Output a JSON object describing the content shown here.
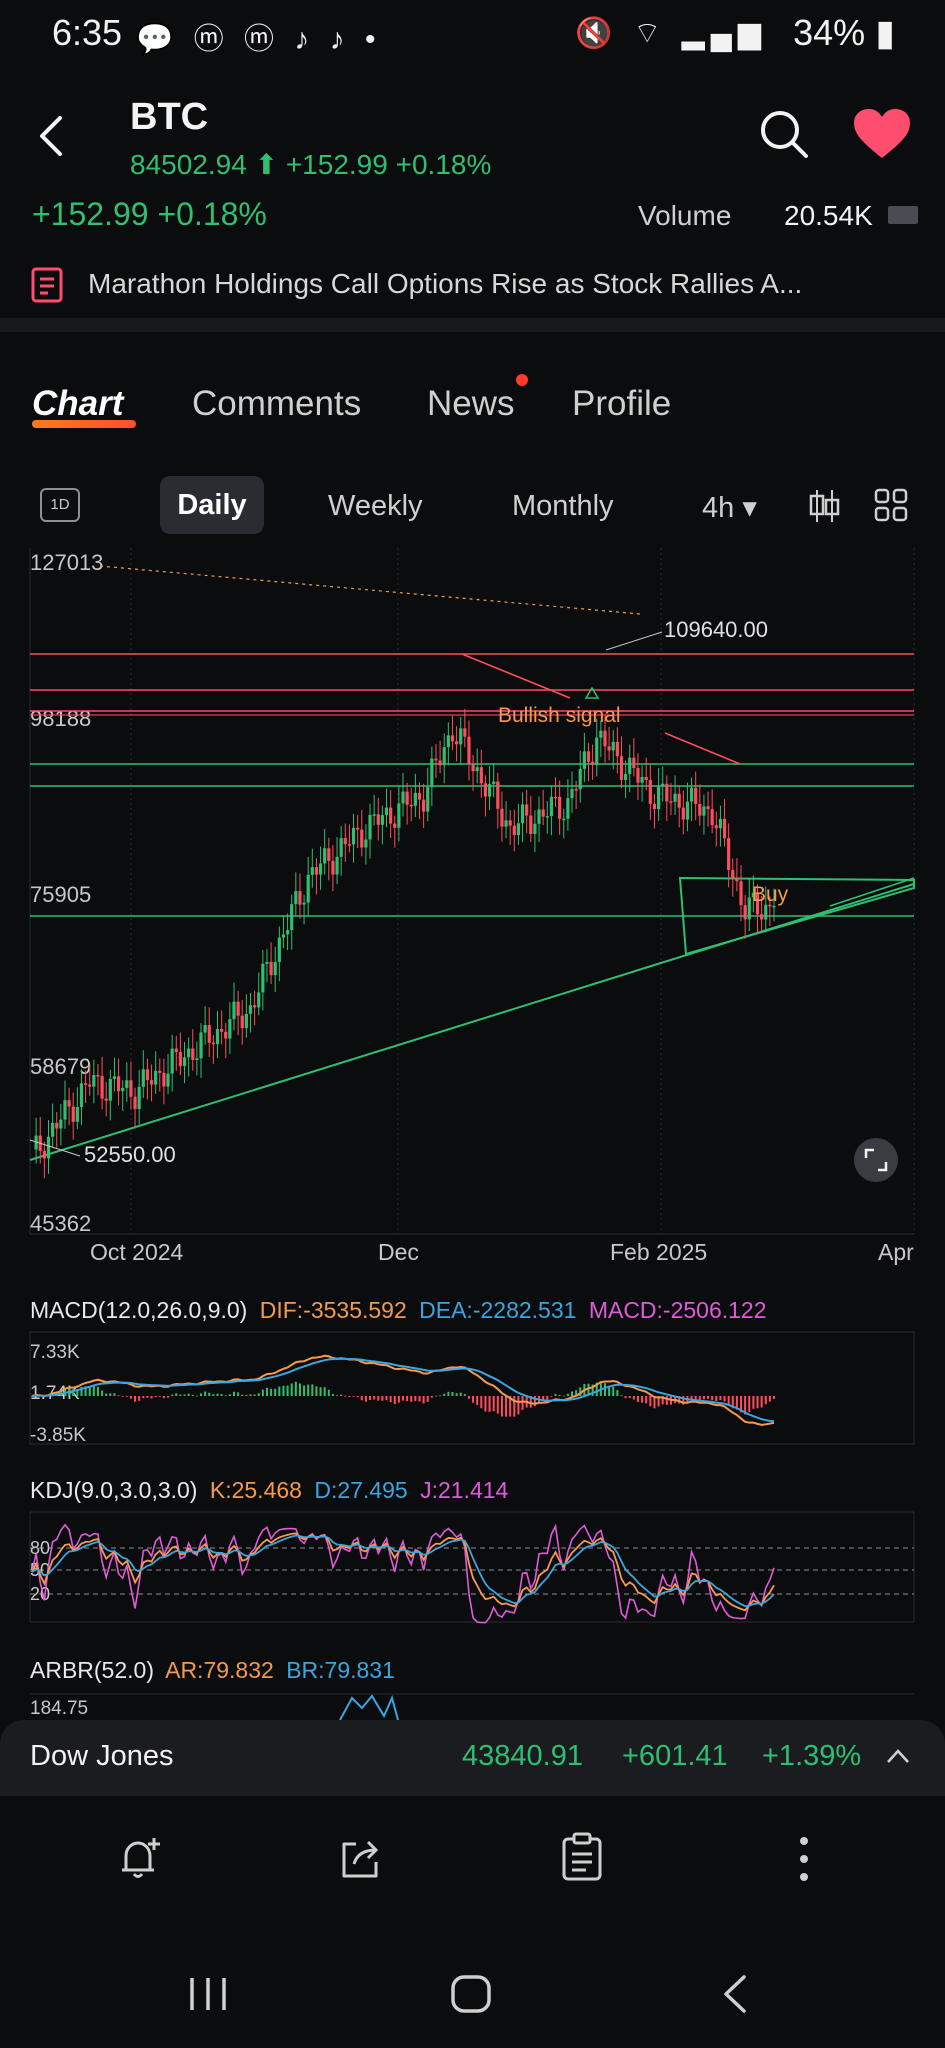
{
  "status_bar": {
    "time": "6:35",
    "left_icons": "💬 ⓜ ⓜ ♪ ♪ •",
    "battery": "34%",
    "right_icons": "🔇 ⌔ ▂▄▆"
  },
  "header": {
    "title": "BTC",
    "price": "84502.94",
    "arrow": "⬆",
    "change": "+152.99",
    "change_pct": "+0.18%"
  },
  "scrolled_row": {
    "change_ghost": "+152.99 +0.18%",
    "volume_label": "Volume",
    "volume_value": "20.54K"
  },
  "news_banner": {
    "text": "Marathon Holdings Call Options Rise as Stock Rallies A..."
  },
  "tabs": [
    {
      "label": "Chart",
      "active": true
    },
    {
      "label": "Comments",
      "active": false
    },
    {
      "label": "News",
      "active": false
    },
    {
      "label": "Profile",
      "active": false
    }
  ],
  "periods": {
    "oned_label": "1D",
    "items": [
      "Daily",
      "Weekly",
      "Monthly",
      "4h ▾"
    ],
    "selected": "Daily"
  },
  "colors": {
    "up": "#2fbf71",
    "down": "#ff4d5e",
    "orange": "#f59a4c",
    "blue": "#3aa6e0",
    "pink": "#e05ad9"
  },
  "chart_data": {
    "type": "candlestick",
    "y_labels": [
      "127013",
      "98188",
      "75905",
      "58679",
      "45362"
    ],
    "x_labels": [
      "Oct 2024",
      "Dec",
      "Feb 2025",
      "Apr"
    ],
    "annotations": {
      "high_label": "109640.00",
      "low_label": "52550.00",
      "signal_label": "Bullish signal",
      "buy_label": "Buy"
    },
    "ylim": [
      45362,
      127013
    ],
    "series": [
      {
        "date": "2024-09-06",
        "close": 54000
      },
      {
        "date": "2024-09-20",
        "close": 63000
      },
      {
        "date": "2024-10-01",
        "close": 62000
      },
      {
        "date": "2024-10-15",
        "close": 67000
      },
      {
        "date": "2024-10-29",
        "close": 72000
      },
      {
        "date": "2024-11-12",
        "close": 88000
      },
      {
        "date": "2024-11-26",
        "close": 94000
      },
      {
        "date": "2024-12-10",
        "close": 98000
      },
      {
        "date": "2024-12-17",
        "close": 106000
      },
      {
        "date": "2024-12-31",
        "close": 94000
      },
      {
        "date": "2025-01-14",
        "close": 97000
      },
      {
        "date": "2025-01-21",
        "close": 105000
      },
      {
        "date": "2025-02-04",
        "close": 98000
      },
      {
        "date": "2025-02-18",
        "close": 96000
      },
      {
        "date": "2025-02-26",
        "close": 84000
      },
      {
        "date": "2025-03-05",
        "close": 84500
      }
    ]
  },
  "indicators": {
    "macd": {
      "title": "MACD(12.0,26.0,9.0)",
      "dif": "DIF:-3535.592",
      "dea": "DEA:-2282.531",
      "macd": "MACD:-2506.122",
      "y_labels": [
        "7.33K",
        "1.74K",
        "-3.85K"
      ]
    },
    "kdj": {
      "title": "KDJ(9.0,3.0,3.0)",
      "k": "K:25.468",
      "d": "D:27.495",
      "j": "J:21.414",
      "y_labels": [
        "80",
        "50",
        "20"
      ]
    },
    "arbr": {
      "title": "ARBR(52.0)",
      "ar": "AR:79.832",
      "br": "BR:79.831",
      "y_label": "184.75"
    }
  },
  "bottom_ticker": {
    "name": "Dow Jones",
    "value": "43840.91",
    "change": "+601.41",
    "change_pct": "+1.39%"
  }
}
